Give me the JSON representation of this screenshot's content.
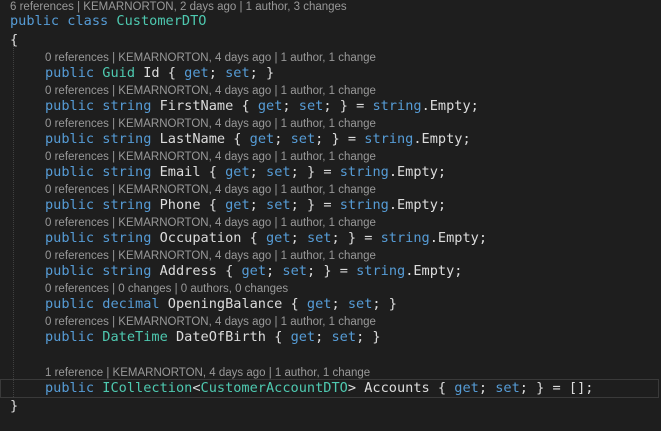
{
  "class_header": {
    "lens": "6 references | KEMARNORTON, 2 days ago | 1 author, 3 changes",
    "kw_public": "public",
    "kw_class": "class",
    "name": "CustomerDTO"
  },
  "braces": {
    "open": "{",
    "close": "}"
  },
  "properties": [
    {
      "lens": "0 references | KEMARNORTON, 4 days ago | 1 author, 1 change",
      "kw": "public",
      "type": "Guid",
      "type_is_keyword": false,
      "name": "Id",
      "accessors": "{ get; set; }",
      "initializer": ""
    },
    {
      "lens": "0 references | KEMARNORTON, 4 days ago | 1 author, 1 change",
      "kw": "public",
      "type": "string",
      "type_is_keyword": true,
      "name": "FirstName",
      "accessors": "{ get; set; }",
      "initializer": "string.Empty;"
    },
    {
      "lens": "0 references | KEMARNORTON, 4 days ago | 1 author, 1 change",
      "kw": "public",
      "type": "string",
      "type_is_keyword": true,
      "name": "LastName",
      "accessors": "{ get; set; }",
      "initializer": "string.Empty;"
    },
    {
      "lens": "0 references | KEMARNORTON, 4 days ago | 1 author, 1 change",
      "kw": "public",
      "type": "string",
      "type_is_keyword": true,
      "name": "Email",
      "accessors": "{ get; set; }",
      "initializer": "string.Empty;"
    },
    {
      "lens": "0 references | KEMARNORTON, 4 days ago | 1 author, 1 change",
      "kw": "public",
      "type": "string",
      "type_is_keyword": true,
      "name": "Phone",
      "accessors": "{ get; set; }",
      "initializer": "string.Empty;"
    },
    {
      "lens": "0 references | KEMARNORTON, 4 days ago | 1 author, 1 change",
      "kw": "public",
      "type": "string",
      "type_is_keyword": true,
      "name": "Occupation",
      "accessors": "{ get; set; }",
      "initializer": "string.Empty;"
    },
    {
      "lens": "0 references | KEMARNORTON, 4 days ago | 1 author, 1 change",
      "kw": "public",
      "type": "string",
      "type_is_keyword": true,
      "name": "Address",
      "accessors": "{ get; set; }",
      "initializer": "string.Empty;"
    },
    {
      "lens": "0 references | 0 changes | 0 authors, 0 changes",
      "kw": "public",
      "type": "decimal",
      "type_is_keyword": true,
      "name": "OpeningBalance",
      "accessors": "{ get; set; }",
      "initializer": ""
    },
    {
      "lens": "0 references | KEMARNORTON, 4 days ago | 1 author, 1 change",
      "kw": "public",
      "type": "DateTime",
      "type_is_keyword": false,
      "name": "DateOfBirth",
      "accessors": "{ get; set; }",
      "initializer": ""
    }
  ],
  "accounts_property": {
    "lens": "1 reference | KEMARNORTON, 4 days ago | 1 author, 1 change",
    "kw": "public",
    "type": "ICollection",
    "generic_open": "<",
    "generic_type": "CustomerAccountDTO",
    "generic_close": ">",
    "name": "Accounts",
    "accessors": "{ get; set; }",
    "initializer": "[];"
  },
  "colors": {
    "background": "#1e1e1e",
    "keyword": "#569cd6",
    "type": "#4ec9b0",
    "identifier": "#dcdcdc",
    "codelens": "#999999"
  }
}
